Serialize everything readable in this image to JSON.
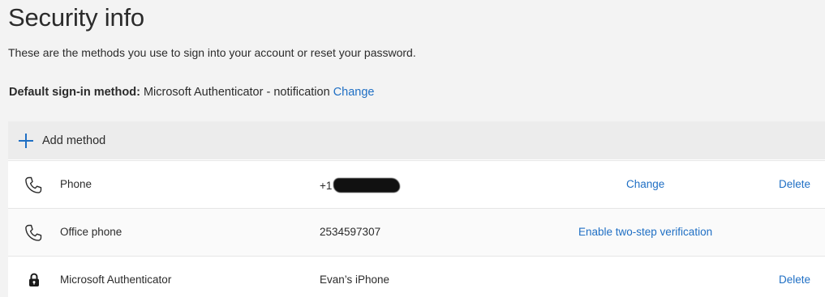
{
  "page": {
    "title": "Security info",
    "subtitle": "These are the methods you use to sign into your account or reset your password."
  },
  "default_method": {
    "label": "Default sign-in method:",
    "value": "Microsoft Authenticator - notification",
    "change_label": "Change"
  },
  "add_method": {
    "label": "Add method",
    "icon": "plus-icon"
  },
  "methods": [
    {
      "icon": "phone-icon",
      "name": "Phone",
      "detail": "+1",
      "detail_redacted": true,
      "action": "Change",
      "delete": "Delete"
    },
    {
      "icon": "phone-icon",
      "name": "Office phone",
      "detail": "2534597307",
      "action": "Enable two-step verification",
      "delete": ""
    },
    {
      "icon": "lock-icon",
      "name": "Microsoft Authenticator",
      "detail": "Evan’s iPhone",
      "action": "",
      "delete": "Delete"
    }
  ],
  "colors": {
    "link": "#1f6fc4",
    "background": "#f3f3f3",
    "panel": "#ffffff",
    "add_row": "#ececec"
  }
}
